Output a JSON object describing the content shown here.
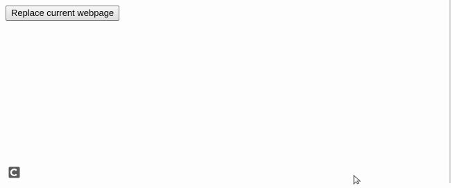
{
  "main": {
    "replace_button_label": "Replace current webpage"
  },
  "icons": {
    "corner_badge": "c-badge-icon",
    "pointer": "mouse-pointer-icon"
  }
}
